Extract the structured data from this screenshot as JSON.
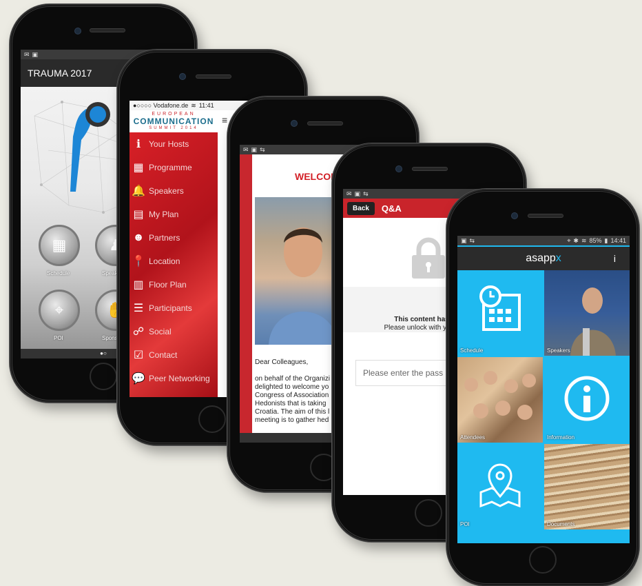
{
  "phone1": {
    "title": "TRAUMA 2017",
    "buttons": [
      {
        "label": "Schedule",
        "icon": "calendar-icon"
      },
      {
        "label": "Speakers",
        "icon": "speaker-icon"
      },
      {
        "label": "POI",
        "icon": "map-icon"
      },
      {
        "label": "Sponsors",
        "icon": "handshake-icon"
      }
    ]
  },
  "phone2": {
    "statusbar": {
      "carrier": "●○○○○ Vodafone.de",
      "time": "11:41"
    },
    "logo": {
      "line1": "EUROPEAN",
      "line2": "COMMUNICATION",
      "line3": "SUMMIT 2014"
    },
    "menu": [
      {
        "label": "Your Hosts",
        "icon": "info-icon"
      },
      {
        "label": "Programme",
        "icon": "calendar-icon"
      },
      {
        "label": "Speakers",
        "icon": "bell-icon"
      },
      {
        "label": "My Plan",
        "icon": "calendar-grid-icon"
      },
      {
        "label": "Partners",
        "icon": "partners-icon"
      },
      {
        "label": "Location",
        "icon": "pin-icon"
      },
      {
        "label": "Floor Plan",
        "icon": "map-icon"
      },
      {
        "label": "Participants",
        "icon": "list-icon"
      },
      {
        "label": "Social",
        "icon": "social-icon"
      },
      {
        "label": "Contact",
        "icon": "check-icon"
      },
      {
        "label": "Peer Networking",
        "icon": "chat-icon"
      }
    ]
  },
  "phone3": {
    "welcome": "WELCOM",
    "salutation": "Dear Colleagues,",
    "body_lines": [
      "on behalf of the Organizi",
      "delighted to welcome yo",
      "Congress of Association",
      "Hedonists that is taking",
      "Croatia. The aim of this l",
      "meeting is to gather hed"
    ]
  },
  "phone4": {
    "back_label": "Back",
    "title": "Q&A",
    "locked_title": "This content has bee",
    "locked_sub": "Please unlock with your pass",
    "password_placeholder": "Please enter the pass"
  },
  "phone5": {
    "statusbar": {
      "battery": "85%",
      "time": "14:41"
    },
    "brand": "asapp",
    "brand_suffix": "x",
    "tiles": [
      {
        "label": "Schedule"
      },
      {
        "label": "Speakers"
      },
      {
        "label": "Attendees"
      },
      {
        "label": "Information"
      },
      {
        "label": "POI"
      },
      {
        "label": "Documents"
      }
    ]
  },
  "colors": {
    "background": "#ecebe3",
    "red": "#c9242b",
    "cyan": "#1fbaf0",
    "dark": "#2b2b2b"
  }
}
